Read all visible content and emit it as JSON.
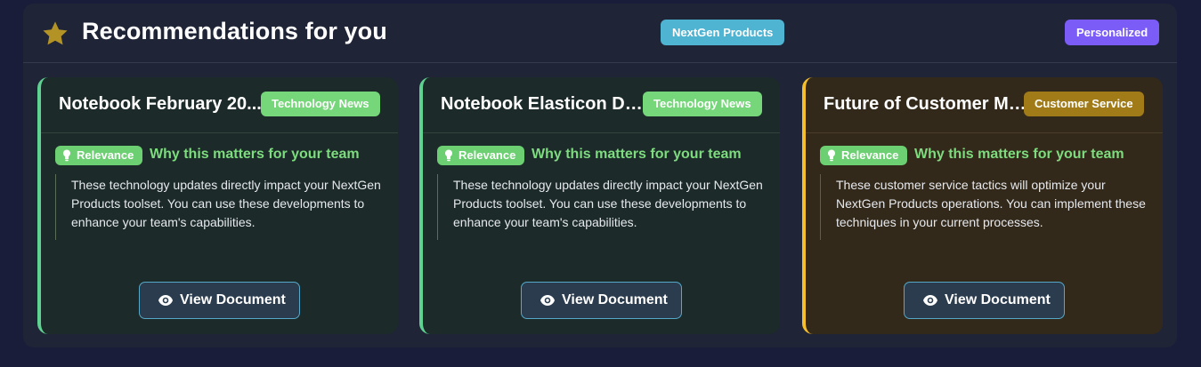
{
  "header": {
    "title": "Recommendations for you",
    "icon": "star-icon",
    "badges": [
      "NextGen Products",
      "Personalized"
    ]
  },
  "colors": {
    "green_accent": "#5fd190",
    "yellow_accent": "#f4be2c",
    "nextgen_badge": "#4fb3d2",
    "personalized_badge": "#7b5cf6"
  },
  "cards": [
    {
      "title": "Notebook February 20...",
      "tag": "Technology News",
      "relevance_label": "Relevance",
      "why": "Why this matters for your team",
      "description": "These technology updates directly impact your NextGen Products toolset. You can use these developments to enhance your team's capabilities.",
      "button": "View Document"
    },
    {
      "title": "Notebook Elasticon De...",
      "tag": "Technology News",
      "relevance_label": "Relevance",
      "why": "Why this matters for your team",
      "description": "These technology updates directly impact your NextGen Products toolset. You can use these developments to enhance your team's capabilities.",
      "button": "View Document"
    },
    {
      "title": "Future of Customer Ma...",
      "tag": "Customer Service",
      "relevance_label": "Relevance",
      "why": "Why this matters for your team",
      "description": "These customer service tactics will optimize your NextGen Products operations. You can implement these techniques in your current processes.",
      "button": "View Document"
    }
  ]
}
